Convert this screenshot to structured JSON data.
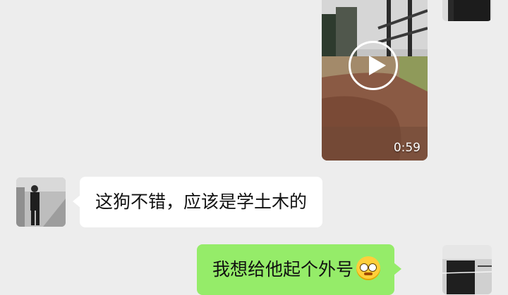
{
  "messages": {
    "video": {
      "duration": "0:59"
    },
    "incoming": {
      "text": "这狗不错，应该是学土木的"
    },
    "outgoing": {
      "text": "我想给他起个外号",
      "emoji": "grinning-face-emoji"
    }
  },
  "colors": {
    "background": "#ededed",
    "incoming_bubble": "#ffffff",
    "outgoing_bubble": "#95ec69"
  }
}
